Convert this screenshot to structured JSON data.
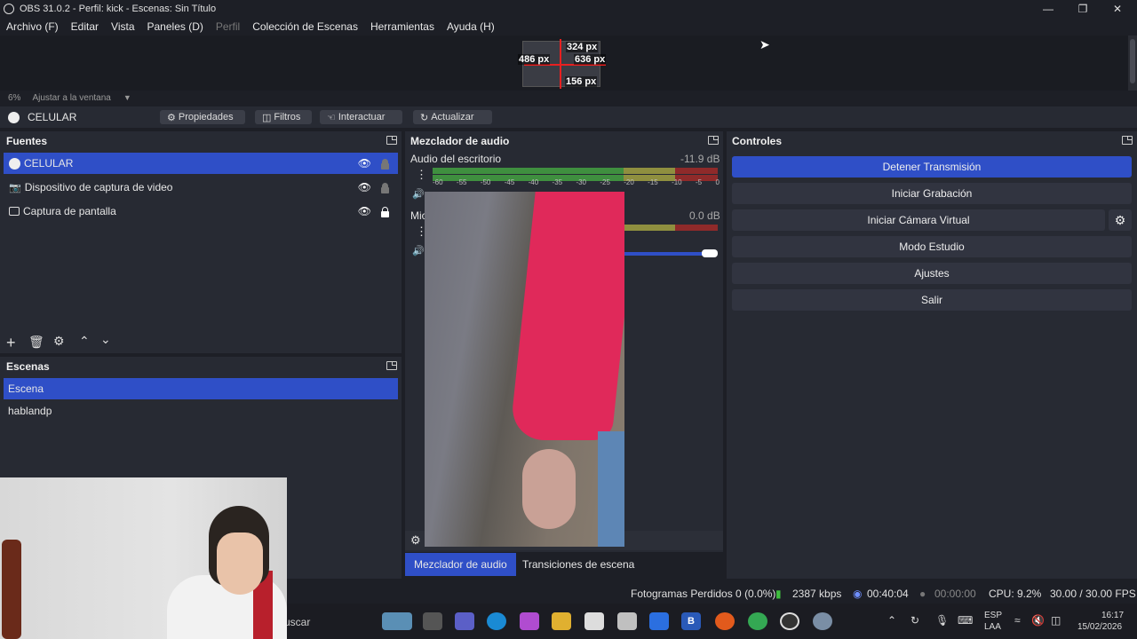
{
  "window": {
    "title": "OBS 31.0.2 - Perfil: kick - Escenas: Sin Título"
  },
  "menu": [
    "Archivo (F)",
    "Editar",
    "Vista",
    "Paneles (D)",
    "Perfil",
    "Colección de Escenas",
    "Herramientas",
    "Ayuda (H)"
  ],
  "preview": {
    "px_top": "324 px",
    "px_left": "486 px",
    "px_right": "636 px",
    "px_bottom": "156 px",
    "zoom": "6%",
    "zoom_mode": "Ajustar a la ventana"
  },
  "source_toolbar": {
    "selected": "CELULAR",
    "properties": "Propiedades",
    "filters": "Filtros",
    "interact": "Interactuar",
    "refresh": "Actualizar"
  },
  "sources": {
    "title": "Fuentes",
    "items": [
      {
        "label": "CELULAR",
        "icon": "browser-icon"
      },
      {
        "label": "Dispositivo de captura de video",
        "icon": "camera-icon"
      },
      {
        "label": "Captura de pantalla",
        "icon": "monitor-icon"
      }
    ]
  },
  "scenes": {
    "title": "Escenas",
    "items": [
      "Escena",
      "hablandp"
    ]
  },
  "mixer": {
    "title": "Mezclador de audio",
    "channels": [
      {
        "name": "Audio del escritorio",
        "db": "-11.9 dB"
      },
      {
        "name": "Mic",
        "db": "0.0 dB"
      }
    ],
    "ticks": [
      "-60",
      "-55",
      "-50",
      "-45",
      "-40",
      "-35",
      "-30",
      "-25",
      "-20",
      "-15",
      "-10",
      "-5",
      "0"
    ]
  },
  "controls": {
    "title": "Controles",
    "buttons": [
      "Detener Transmisión",
      "Iniciar Grabación",
      "Iniciar Cámara Virtual",
      "Modo Estudio",
      "Ajustes",
      "Salir"
    ]
  },
  "tabs": [
    "Mezclador de audio",
    "Transiciones de escena"
  ],
  "status": {
    "dropped": "Fotogramas Perdidos 0 (0.0%)",
    "bitrate": "2387 kbps",
    "stream_time": "00:40:04",
    "rec_time": "00:00:00",
    "cpu": "CPU: 9.2%",
    "fps": "30.00 / 30.00 FPS"
  },
  "taskbar": {
    "search": "uscar",
    "lang1": "ESP",
    "lang2": "LAA",
    "time": "16:17",
    "date": "15/02/2026"
  },
  "colors": {
    "accent": "#2f4fc7",
    "panel": "#272a33",
    "background": "#1d1f26"
  }
}
